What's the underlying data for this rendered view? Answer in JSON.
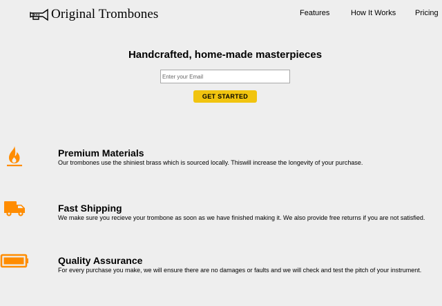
{
  "brand": {
    "name": "Original Trombones",
    "icon": "trombone-icon"
  },
  "nav": {
    "items": [
      {
        "label": "Features"
      },
      {
        "label": "How It Works"
      },
      {
        "label": "Pricing"
      }
    ]
  },
  "hero": {
    "title": "Handcrafted, home-made masterpieces",
    "email_placeholder": "Enter your Email",
    "email_value": "",
    "cta_label": "GET STARTED"
  },
  "features": [
    {
      "icon": "fire-icon",
      "title": "Premium Materials",
      "description": "Our trombones use the shiniest brass which is sourced locally. Thiswill increase the longevity of your purchase."
    },
    {
      "icon": "truck-icon",
      "title": "Fast Shipping",
      "description": "We make sure you recieve your trombone as soon as we have finished making it. We also provide free returns if you are not satisfied."
    },
    {
      "icon": "battery-icon",
      "title": "Quality Assurance",
      "description": "For every purchase you make, we will ensure there are no damages or faults and we will check and test the pitch of your instrument."
    }
  ],
  "colors": {
    "background": "#eeeeee",
    "accent": "#f1c40f",
    "icon_orange": "#ff8c00"
  }
}
